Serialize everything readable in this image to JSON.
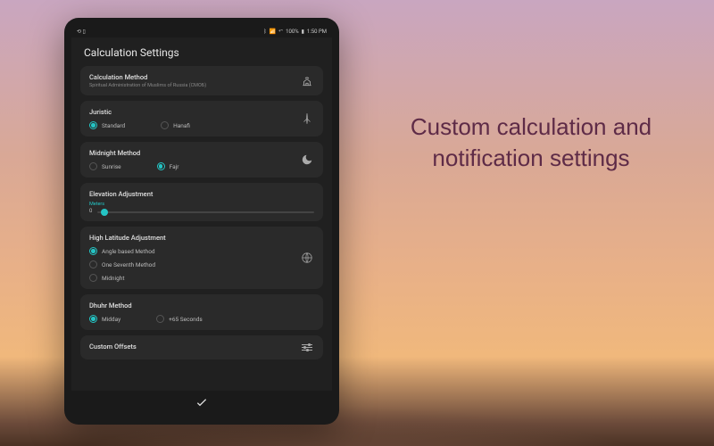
{
  "marketing": {
    "headline": "Custom calculation and notification settings"
  },
  "status_bar": {
    "left_icons": [
      "orientation-lock-icon",
      "sim-icon"
    ],
    "right": {
      "bluetooth": "bluetooth-icon",
      "wifi": "wifi-icon",
      "battery_pct": "100%",
      "battery_icon": "battery-full-icon",
      "time": "1:50 PM"
    }
  },
  "page": {
    "title": "Calculation Settings"
  },
  "sections": {
    "calc_method": {
      "title": "Calculation Method",
      "subtitle": "Spiritual Administration of Muslims of Russia (СМОБ)",
      "icon": "mosque-icon"
    },
    "juristic": {
      "title": "Juristic",
      "options": [
        {
          "label": "Standard",
          "selected": true
        },
        {
          "label": "Hanafi",
          "selected": false
        }
      ],
      "icon": "compass-icon"
    },
    "midnight": {
      "title": "Midnight Method",
      "options": [
        {
          "label": "Sunrise",
          "selected": false
        },
        {
          "label": "Fajr",
          "selected": true
        }
      ],
      "icon": "moon-icon"
    },
    "elevation": {
      "title": "Elevation Adjustment",
      "slider_label": "Meters",
      "value": "0"
    },
    "high_lat": {
      "title": "High Latitude Adjustment",
      "options": [
        {
          "label": "Angle based Method",
          "selected": true
        },
        {
          "label": "One Seventh Method",
          "selected": false
        },
        {
          "label": "Midnight",
          "selected": false
        }
      ],
      "icon": "globe-icon"
    },
    "dhuhr": {
      "title": "Dhuhr Method",
      "options": [
        {
          "label": "Midday",
          "selected": true
        },
        {
          "label": "+65 Seconds",
          "selected": false
        }
      ]
    },
    "custom_offsets": {
      "title": "Custom Offsets",
      "icon": "sliders-icon"
    }
  },
  "bottom": {
    "confirm_icon": "check-icon"
  }
}
